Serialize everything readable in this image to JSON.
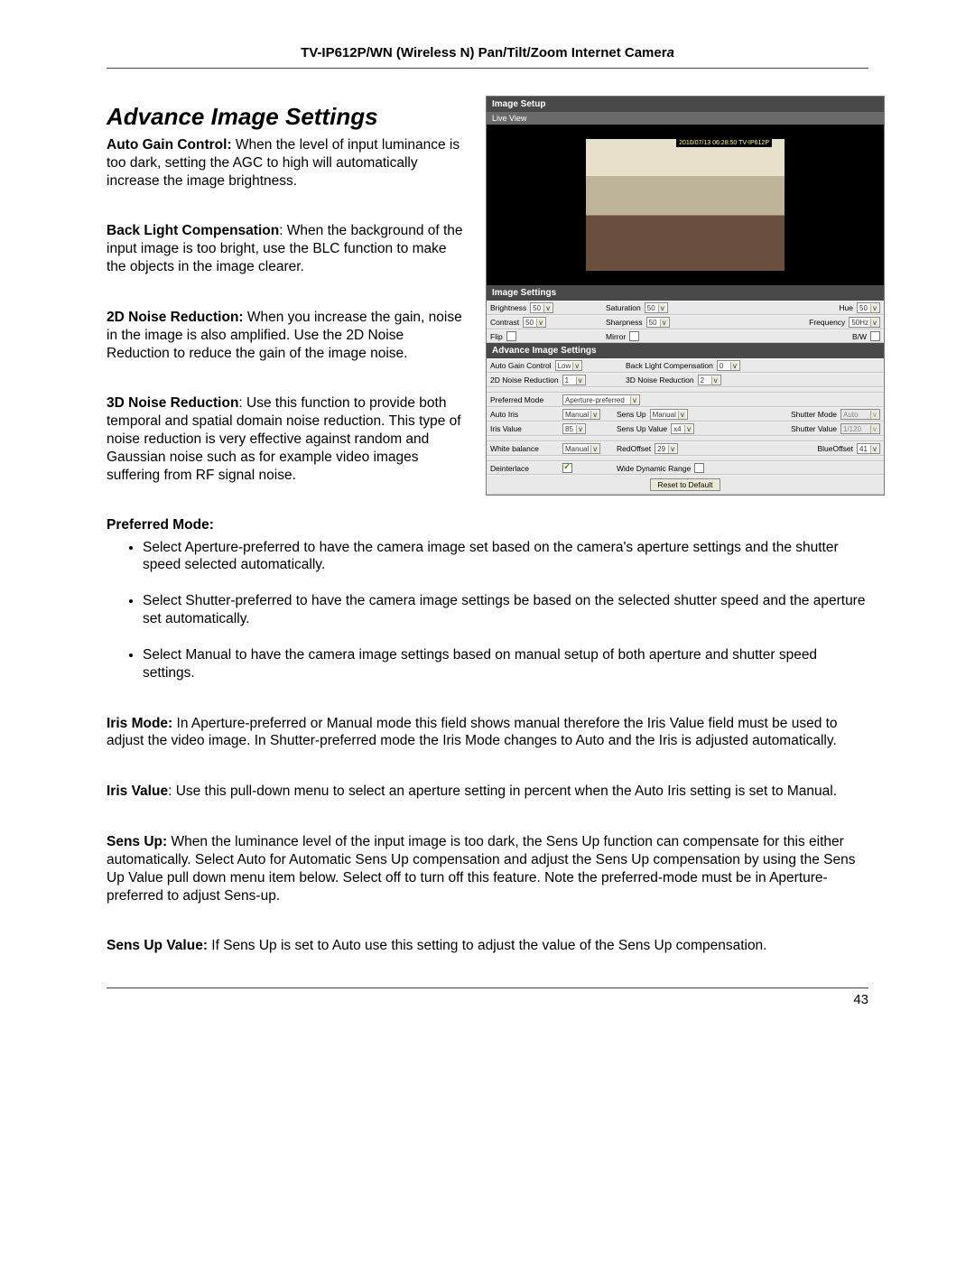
{
  "header": {
    "prefix": "TV-IP612P/WN (Wireless N) Pan/Tilt/Zoom Internet Camer",
    "suffix": "a"
  },
  "title": "Advance Image Settings",
  "descriptions": {
    "agc_label": "Auto Gain Control:",
    "agc_text": "  When the level of input luminance is too dark, setting the AGC to high will automatically increase the image brightness.",
    "blc_label": "Back Light Compensation",
    "blc_text": ": When the background of the input image is too bright, use the BLC function to make the objects in the image clearer.",
    "nr2d_label": "2D Noise Reduction:",
    "nr2d_text": " When you increase the gain, noise in the image is also amplified. Use the 2D Noise Reduction to reduce the gain of the image noise.",
    "nr3d_label": "3D Noise Reduction",
    "nr3d_text": ": Use this function to provide both temporal and spatial domain noise reduction.  This type of noise reduction is very effective against random and Gaussian noise such as for example video images suffering from RF signal noise."
  },
  "preferred_mode": {
    "title": "Preferred Mode:",
    "bullets": [
      "Select Aperture-preferred to have the camera image set based on the camera's aperture settings and the shutter speed selected automatically.",
      "Select Shutter-preferred to have the camera image settings be based on the selected shutter speed and the aperture set automatically.",
      "Select Manual to have the camera image settings based on manual setup of both aperture and shutter speed settings."
    ]
  },
  "paras": {
    "iris_mode_label": "Iris Mode:",
    "iris_mode_text": " In Aperture-preferred or Manual mode this field shows manual therefore the Iris Value field must be used to adjust the video image.  In Shutter-preferred mode the Iris Mode changes to Auto and the Iris is adjusted automatically.",
    "iris_value_label": "Iris Value",
    "iris_value_text": ": Use this pull-down menu to select an aperture setting in percent when the Auto Iris setting is set to Manual.",
    "sensup_label": "Sens Up:",
    "sensup_text": " When the luminance level of the input image is too dark, the Sens Up function can compensate for this either automatically. Select Auto for Automatic Sens Up compensation and adjust the Sens Up compensation by using the Sens Up Value pull down menu item below. Select off to turn off this feature. Note the preferred-mode must be in Aperture-preferred to adjust Sens-up.",
    "sensup_val_label": "Sens Up Value:",
    "sensup_val_text": " If Sens Up is set to Auto use this setting to adjust the value of the Sens Up compensation."
  },
  "page_number": "43",
  "panel": {
    "title": "Image Setup",
    "live": {
      "tab": "Live View",
      "timestamp": "2010/07/13 06:28:50 TV-IP612P"
    },
    "image_settings": {
      "heading": "Image Settings",
      "brightness_label": "Brightness",
      "brightness": "50",
      "saturation_label": "Saturation",
      "saturation": "50",
      "hue_label": "Hue",
      "hue": "50",
      "contrast_label": "Contrast",
      "contrast": "50",
      "sharpness_label": "Sharpness",
      "sharpness": "50",
      "frequency_label": "Frequency",
      "frequency": "50Hz",
      "flip_label": "Flip",
      "mirror_label": "Mirror",
      "bw_label": "B/W"
    },
    "adv": {
      "heading": "Advance Image Settings",
      "agc_label": "Auto Gain Control",
      "agc": "Low",
      "blc_label": "Back Light Compensation",
      "blc": "0",
      "nr2d_label": "2D Noise Reduction",
      "nr2d": "1",
      "nr3d_label": "3D Noise Reduction",
      "nr3d": "2",
      "pref_mode_label": "Preferred Mode",
      "pref_mode": "Aperture-preferred",
      "auto_iris_label": "Auto Iris",
      "auto_iris": "Manual",
      "sensup_label": "Sens Up",
      "sensup": "Manual",
      "shutter_mode_label": "Shutter Mode",
      "shutter_mode": "Auto",
      "iris_value_label": "Iris Value",
      "iris_value": "85",
      "sensup_val_label": "Sens Up Value",
      "sensup_val": "x4",
      "shutter_val_label": "Shutter Value",
      "shutter_val": "1/120",
      "wb_label": "White balance",
      "wb": "Manual",
      "red_label": "RedOffset",
      "red": "29",
      "blue_label": "BlueOffset",
      "blue": "41",
      "deint_label": "Deinterlace",
      "wdr_label": "Wide Dynamic Range",
      "reset": "Reset to Default"
    }
  }
}
